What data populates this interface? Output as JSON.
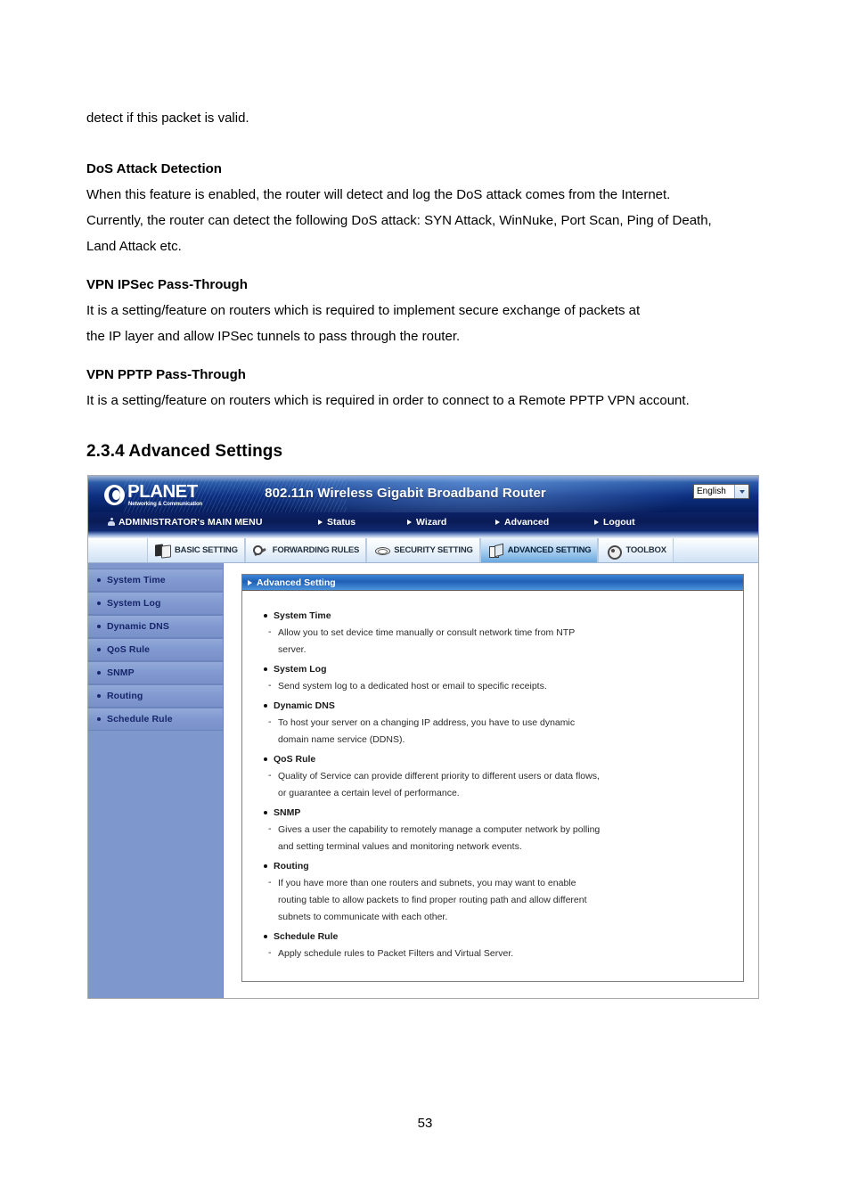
{
  "document": {
    "intro_line": "detect if this packet is valid.",
    "sections": [
      {
        "heading": "DoS Attack Detection",
        "lines": [
          "When this feature is enabled, the router will detect and log the DoS attack comes from the Internet.",
          "Currently, the router can detect the following DoS attack: SYN Attack, WinNuke, Port Scan, Ping of Death,",
          "Land Attack etc."
        ]
      },
      {
        "heading": "VPN IPSec Pass-Through",
        "lines": [
          "It is a setting/feature on routers which is required to implement secure exchange of packets at",
          "the IP layer and allow IPSec tunnels to pass through the router."
        ]
      },
      {
        "heading": "VPN PPTP Pass-Through",
        "lines": [
          "It is a setting/feature on routers which is required in order to connect to a Remote PPTP VPN account."
        ]
      }
    ],
    "section_title": "2.3.4 Advanced Settings",
    "page_number": "53"
  },
  "router_ui": {
    "brand": {
      "name": "PLANET",
      "tagline": "Networking & Communication"
    },
    "banner_title": "802.11n Wireless Gigabit Broadband Router",
    "language": {
      "selected": "English",
      "options": [
        "English"
      ]
    },
    "nav": {
      "main_menu": "ADMINISTRATOR's MAIN MENU",
      "items": [
        {
          "label": "Status"
        },
        {
          "label": "Wizard"
        },
        {
          "label": "Advanced"
        },
        {
          "label": "Logout"
        }
      ]
    },
    "tabs": [
      {
        "label": "BASIC SETTING",
        "icon": "book-icon",
        "active": false
      },
      {
        "label": "FORWARDING RULES",
        "icon": "wrench-icon",
        "active": false
      },
      {
        "label": "SECURITY SETTING",
        "icon": "shield-icon",
        "active": false
      },
      {
        "label": "ADVANCED SETTING",
        "icon": "cube-icon",
        "active": true
      },
      {
        "label": "TOOLBOX",
        "icon": "gear-icon",
        "active": false
      }
    ],
    "sidebar": {
      "items": [
        {
          "label": "System Time"
        },
        {
          "label": "System Log"
        },
        {
          "label": "Dynamic DNS"
        },
        {
          "label": "QoS Rule"
        },
        {
          "label": "SNMP"
        },
        {
          "label": "Routing"
        },
        {
          "label": "Schedule Rule"
        }
      ]
    },
    "panel": {
      "title": "Advanced Setting",
      "features": [
        {
          "name": "System Time",
          "desc_lines": [
            "Allow you to set device time manually or consult network time from NTP",
            "server."
          ]
        },
        {
          "name": "System Log",
          "desc_lines": [
            "Send system log to a dedicated host or email to specific receipts."
          ]
        },
        {
          "name": "Dynamic DNS",
          "desc_lines": [
            "To host your server on a changing IP address, you have to use dynamic",
            "domain name service (DDNS)."
          ]
        },
        {
          "name": "QoS Rule",
          "desc_lines": [
            "Quality of Service can provide different priority to different users or data flows,",
            "or guarantee a certain level of performance."
          ]
        },
        {
          "name": "SNMP",
          "desc_lines": [
            "Gives a user the capability to remotely manage a computer network by polling",
            "and setting terminal values and monitoring network events."
          ]
        },
        {
          "name": "Routing",
          "desc_lines": [
            "If you have more than one routers and subnets, you may want to enable",
            "routing table to allow packets to find proper routing path and allow different",
            "subnets to communicate with each other."
          ]
        },
        {
          "name": "Schedule Rule",
          "desc_lines": [
            "Apply schedule rules to Packet Filters and Virtual Server."
          ]
        }
      ]
    },
    "colors": {
      "banner_dark": "#0d2f80",
      "nav_bar": "#0a1c56",
      "sidebar": "#7e97cd",
      "sidebar_text": "#18256b",
      "panel_header": "#1f5fb4",
      "tab_active": "#6aa8e0"
    }
  }
}
